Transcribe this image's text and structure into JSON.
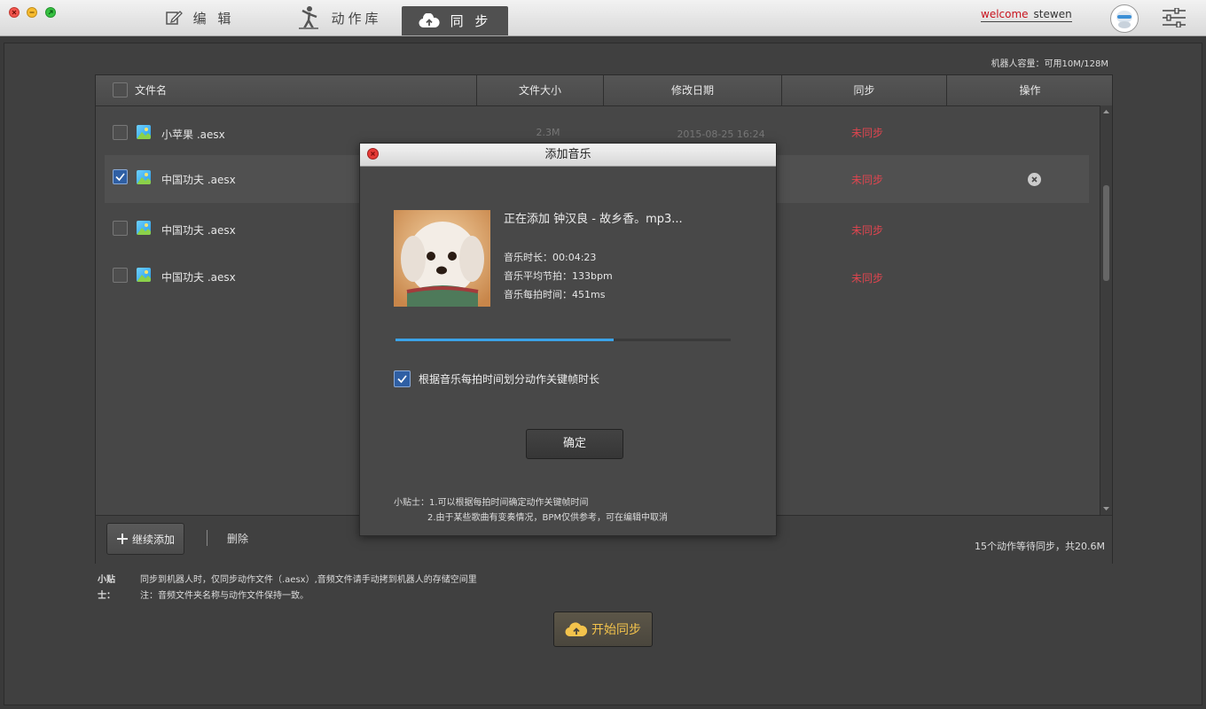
{
  "titlebar": {
    "tabs": [
      {
        "label": "编 辑",
        "icon": "edit-icon"
      },
      {
        "label": "动作库",
        "icon": "dance-figure-icon"
      },
      {
        "label": "同 步",
        "icon": "cloud-upload-icon"
      }
    ],
    "welcome_prefix": "welcome",
    "username": "stewen"
  },
  "capacity": "机器人容量：可用10M/128M",
  "table": {
    "headers": [
      "文件名",
      "文件大小",
      "修改日期",
      "同步",
      "操作"
    ],
    "rows": [
      {
        "name": "小苹果  .aesx",
        "size": "2.3M",
        "date": "2015-08-25  16:24",
        "sync": "未同步",
        "checked": false,
        "selected": false
      },
      {
        "name": "中国功夫  .aesx",
        "size": "",
        "date": "",
        "sync": "未同步",
        "checked": true,
        "selected": true
      },
      {
        "name": "中国功夫  .aesx",
        "size": "",
        "date": "",
        "sync": "未同步",
        "checked": false,
        "selected": false
      },
      {
        "name": "中国功夫  .aesx",
        "size": "",
        "date": "",
        "sync": "未同步",
        "checked": false,
        "selected": false
      }
    ]
  },
  "footer": {
    "add_button": "继续添加",
    "delete_button": "删除",
    "pending": "15个动作等待同步，共20.6M"
  },
  "tips": {
    "label": "小贴士：",
    "line1": "同步到机器人时，仅同步动作文件（.aesx）,音频文件请手动拷到机器人的存储空间里",
    "line2": "注：音频文件夹名称与动作文件保持一致。"
  },
  "sync_button": "开始同步",
  "dialog": {
    "title": "添加音乐",
    "adding_text": "正在添加    钟汉良 - 故乡香。mp3...",
    "duration": "音乐时长：00:04:23",
    "bpm": "音乐平均节拍：133bpm",
    "beat_time": "音乐每拍时间：451ms",
    "progress": 0.65,
    "checkbox_label": "根据音乐每拍时间划分动作关键帧时长",
    "checkbox_checked": true,
    "ok_button": "确定",
    "tip1": "小贴士：1.可以根据每拍时间确定动作关键帧时间",
    "tip2": "2.由于某些歌曲有变奏情况，BPM仅供参考，可在编辑中取消"
  },
  "colors": {
    "unsynced": "#e0454f",
    "sync_accent": "#f3c34c",
    "progress": "#3ba3e8"
  }
}
